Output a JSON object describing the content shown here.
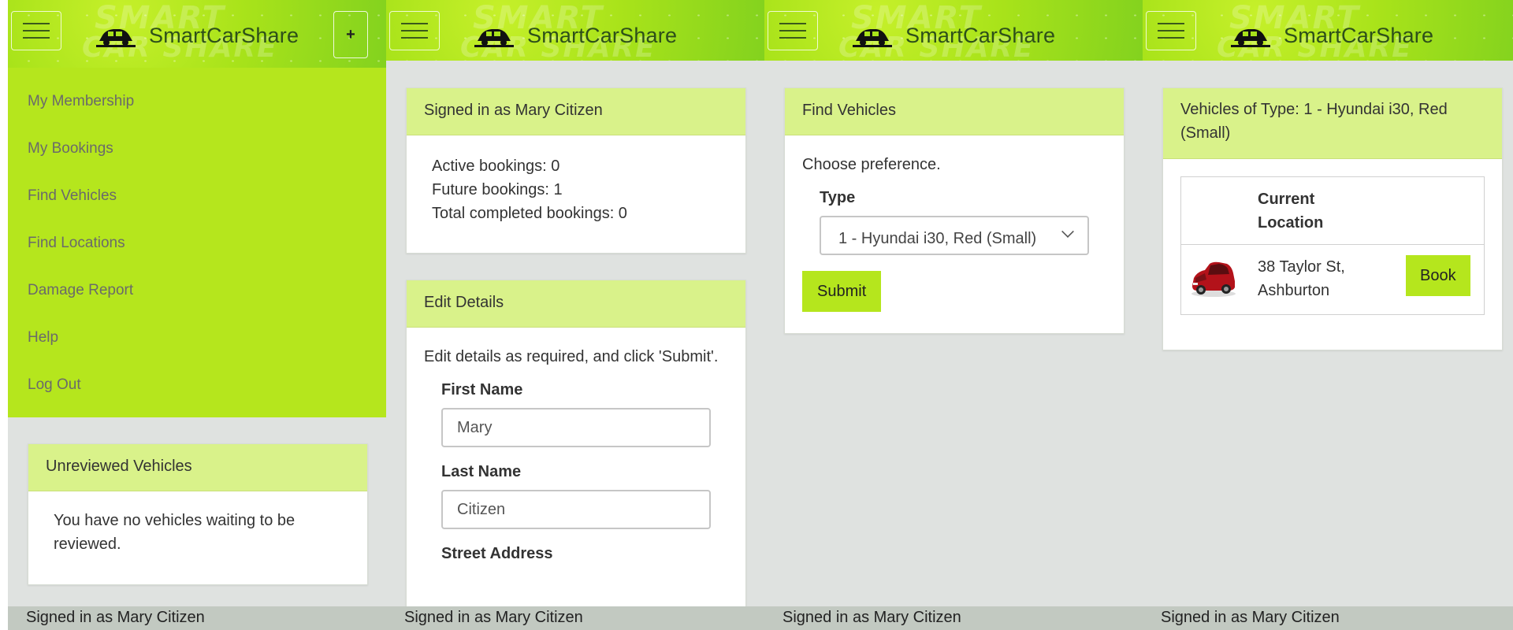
{
  "app": {
    "brand": "SmartCarShare",
    "watermark_line1": "SMART",
    "watermark_line2": "CAR SHARE"
  },
  "colors": {
    "accent_green": "#b5e61d",
    "card_header": "#d9f28a",
    "panel_bg": "#dfe2e0",
    "footer_bg": "#c2c9c1"
  },
  "icons": {
    "menu": "hamburger-icon",
    "logo": "car-logo-icon",
    "add": "plus-icon",
    "vehicle": "red-car-icon"
  },
  "panel1": {
    "plus_label": "+",
    "menu": [
      "My Membership",
      "My Bookings",
      "Find Vehicles",
      "Find Locations",
      "Damage Report",
      "Help",
      "Log Out"
    ],
    "card": {
      "title": "Unreviewed Vehicles",
      "body": "You have no vehicles waiting to be reviewed."
    },
    "footer": "Signed in as Mary Citizen"
  },
  "panel2": {
    "signed_card": {
      "title": "Signed in as Mary Citizen",
      "lines": [
        "Active bookings: 0",
        "Future bookings: 1",
        "Total completed bookings: 0"
      ]
    },
    "edit_card": {
      "title": "Edit Details",
      "intro": "Edit details as required, and click 'Submit'.",
      "first_name_label": "First Name",
      "first_name_value": "Mary",
      "last_name_label": "Last Name",
      "last_name_value": "Citizen",
      "street_label": "Street Address"
    },
    "footer": "Signed in as Mary Citizen"
  },
  "panel3": {
    "card": {
      "title": "Find Vehicles",
      "intro": "Choose preference.",
      "type_label": "Type",
      "type_value": "1 - Hyundai i30, Red (Small)",
      "submit": "Submit"
    },
    "footer": "Signed in as Mary Citizen"
  },
  "panel4": {
    "card": {
      "title": "Vehicles of Type: 1 - Hyundai i30, Red (Small)",
      "col_header": "Current Location",
      "location": "38 Taylor St, Ashburton",
      "book": "Book"
    },
    "footer": "Signed in as Mary Citizen"
  }
}
